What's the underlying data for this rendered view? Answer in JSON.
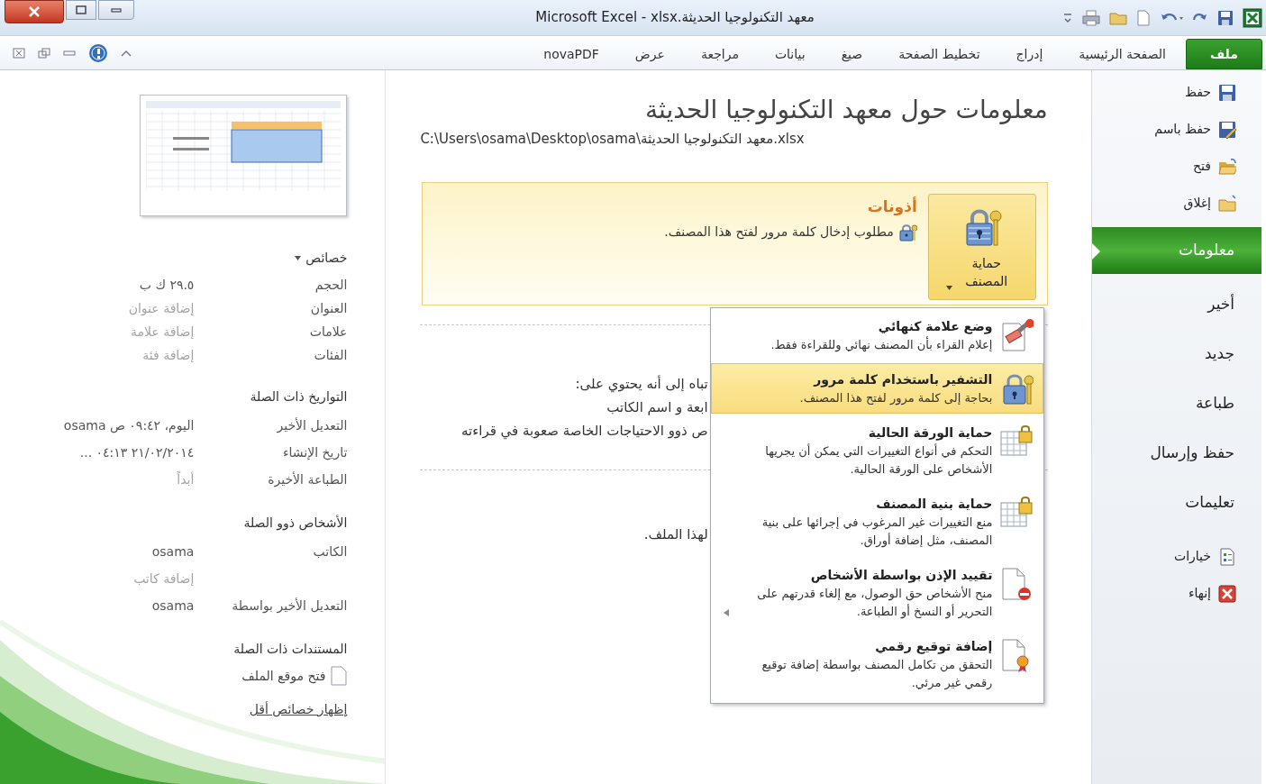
{
  "window": {
    "title": "Microsoft Excel - xlsx.معهد التكنولوجيا الحديثة"
  },
  "ribbon_tabs": [
    {
      "label": "ملف",
      "selected": true
    },
    {
      "label": "الصفحة الرئيسية",
      "selected": false
    },
    {
      "label": "إدراج",
      "selected": false
    },
    {
      "label": "تخطيط الصفحة",
      "selected": false
    },
    {
      "label": "صيغ",
      "selected": false
    },
    {
      "label": "بيانات",
      "selected": false
    },
    {
      "label": "مراجعة",
      "selected": false
    },
    {
      "label": "عرض",
      "selected": false
    },
    {
      "label": "novaPDF",
      "selected": false
    }
  ],
  "backstage_menu": [
    {
      "label": "حفظ",
      "kind": "command",
      "selected": false
    },
    {
      "label": "حفظ باسم",
      "kind": "command",
      "selected": false
    },
    {
      "label": "فتح",
      "kind": "command",
      "selected": false
    },
    {
      "label": "إغلاق",
      "kind": "command",
      "selected": false
    },
    {
      "label": "معلومات",
      "kind": "tab",
      "selected": true
    },
    {
      "label": "أخير",
      "kind": "tab",
      "selected": false
    },
    {
      "label": "جديد",
      "kind": "tab",
      "selected": false
    },
    {
      "label": "طباعة",
      "kind": "tab",
      "selected": false
    },
    {
      "label": "حفظ وإرسال",
      "kind": "tab",
      "selected": false
    },
    {
      "label": "تعليمات",
      "kind": "tab",
      "selected": false
    },
    {
      "label": "خيارات",
      "kind": "command",
      "selected": false
    },
    {
      "label": "إنهاء",
      "kind": "command",
      "selected": false
    }
  ],
  "info": {
    "title": "معلومات حول معهد التكنولوجيا الحديثة",
    "path": "C:\\Users\\osama\\Desktop\\osama\\معهد التكنولوجيا الحديثة.xlsx"
  },
  "permissions": {
    "button_label": "حماية المصنف",
    "heading": "أذونات",
    "note": "مطلوب إدخال كلمة مرور لفتح هذا المصنف."
  },
  "partly_hidden_texts": [
    "تباه إلى أنه يحتوي على:",
    "ابعة و اسم الكاتب",
    "ص ذوو الاحتياجات الخاصة صعوبة في قراءته",
    "لهذا الملف."
  ],
  "protect_menu": [
    {
      "title": "وضع علامة كنهائي",
      "description": "إعلام القراء بأن المصنف نهائي وللقراءة فقط.",
      "selected": false
    },
    {
      "title": "التشفير باستخدام كلمة مرور",
      "description": "بحاجة إلى كلمة مرور لفتح هذا المصنف.",
      "selected": true
    },
    {
      "title": "حماية الورقة الحالية",
      "description": "التحكم في أنواع التغييرات التي يمكن أن يجريها الأشخاص على الورقة الحالية.",
      "selected": false
    },
    {
      "title": "حماية بنية المصنف",
      "description": "منع التغييرات غير المرغوب في إجرائها على بنية المصنف، مثل إضافة أوراق.",
      "selected": false
    },
    {
      "title": "تقييد الإذن بواسطة الأشخاص",
      "description": "منح الأشخاص حق الوصول، مع إلغاء قدرتهم على التحرير أو النسخ أو الطباعة.",
      "selected": false
    },
    {
      "title": "إضافة توقيع رقمي",
      "description": "التحقق من تكامل المصنف بواسطة إضافة توقيع رقمي غير مرئي.",
      "selected": false
    }
  ],
  "properties": {
    "heading": "خصائص",
    "sections": [
      {
        "rows": [
          {
            "label": "الحجم",
            "value": "٢٩.٥ ك ب"
          },
          {
            "label": "العنوان",
            "placeholder": "إضافة عنوان"
          },
          {
            "label": "علامات",
            "placeholder": "إضافة علامة"
          },
          {
            "label": "الفئات",
            "placeholder": "إضافة فئة"
          }
        ]
      },
      {
        "heading": "التواريخ ذات الصلة",
        "rows": [
          {
            "label": "التعديل الأخير",
            "value": "اليوم، ٠٩:٤٢ ص osama"
          },
          {
            "label": "تاريخ الإنشاء",
            "value": "٢١/٠٢/٢٠١٤ ٠٤:١٣ ..."
          },
          {
            "label": "الطباعة الأخيرة",
            "value": "أبداً",
            "dimmed": true
          }
        ]
      },
      {
        "heading": "الأشخاص ذوو الصلة",
        "rows": [
          {
            "label": "الكاتب",
            "value": "osama"
          },
          {
            "placeholder": "إضافة كاتب"
          },
          {
            "label": "التعديل الأخير بواسطة",
            "value": "osama"
          }
        ]
      },
      {
        "heading": "المستندات ذات الصلة"
      }
    ],
    "open_location_link": "فتح موقع الملف",
    "show_fewer_link": "إظهار خصائص أقل"
  }
}
